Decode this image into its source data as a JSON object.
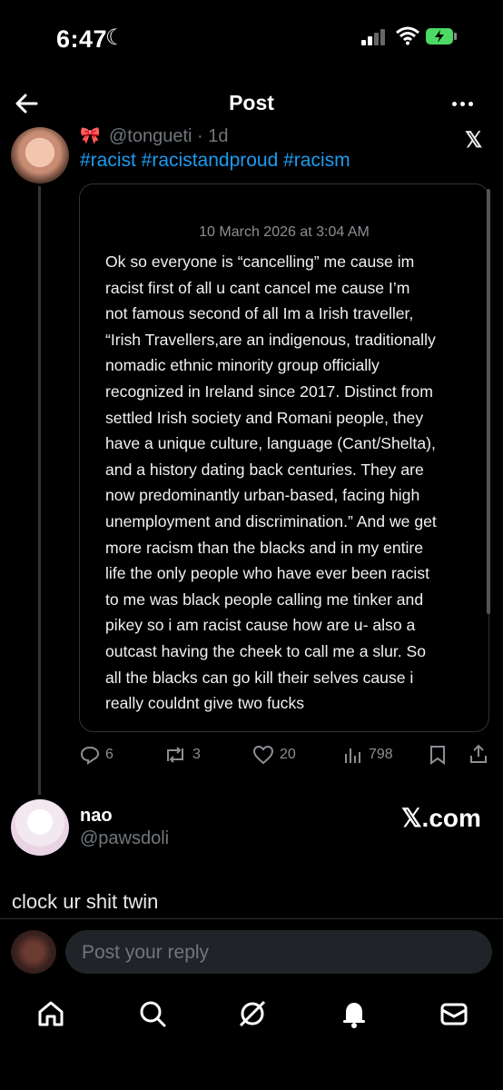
{
  "status_bar": {
    "time": "6:47",
    "moon_icon": "moon-icon"
  },
  "header": {
    "title": "Post"
  },
  "post": {
    "handle": "@tongueti · 1d",
    "hashtags": "#racist #racistandproud #racism",
    "quote": {
      "date": "10 March 2026 at 3:04 AM",
      "text": "Ok so everyone is “cancelling” me cause im\nracist first of all u cant cancel me cause I’m\nnot famous second of all Im a Irish traveller,\n“Irish Travellers,are an indigenous, traditionally\nnomadic ethnic minority group officially\nrecognized in Ireland since 2017. Distinct from\nsettled Irish society and Romani people, they\nhave a unique culture, language (Cant/Shelta),\nand a history dating back centuries. They are\nnow predominantly urban-based, facing high\nunemployment and discrimination.” And we get\nmore racism than the blacks and in my entire\nlife the only people who have ever been racist\nto me was black people calling me tinker and\npikey so i am racist cause how are u- also a\noutcast having the cheek to call me a slur. So\nall the blacks can go kill their selves cause i\nreally couldnt give two fucks"
    },
    "actions": {
      "replies": "6",
      "reposts": "3",
      "likes": "20",
      "views": "798"
    }
  },
  "reply": {
    "name": "nao",
    "handle": "@pawsdoli",
    "watermark": "𝕏.com",
    "text": "clock ur shit twin"
  },
  "composer": {
    "placeholder": "Post your reply"
  },
  "colors": {
    "accent": "#1d9bf0",
    "battery": "#4cd964"
  }
}
